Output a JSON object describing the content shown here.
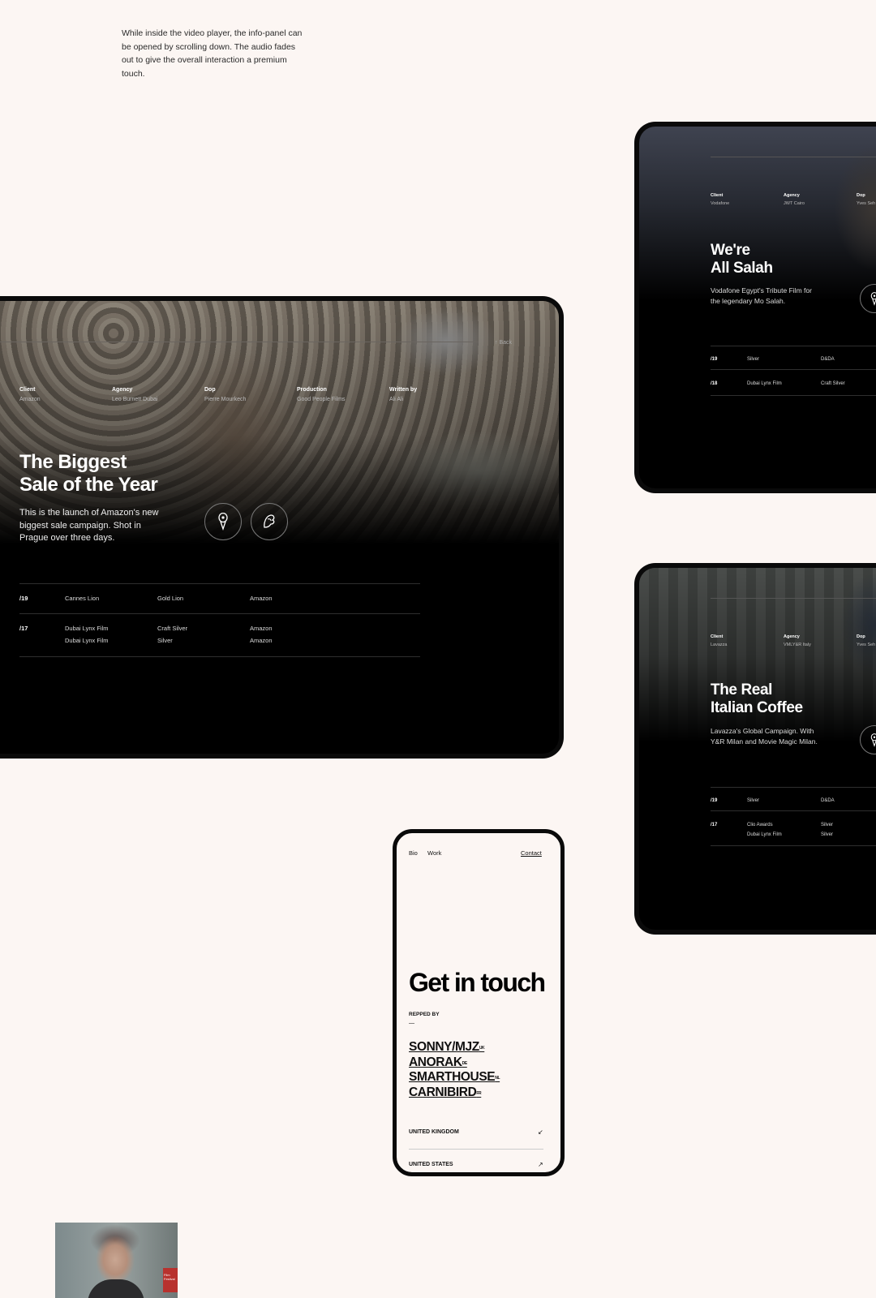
{
  "intro_text": "While inside the video player, the info-panel can be opened by scrolling down. The audio fades out to give the overall interaction a premium touch.",
  "main_project": {
    "back_label": "↑ Back",
    "meta": [
      {
        "key": "Client",
        "value": "Amazon"
      },
      {
        "key": "Agency",
        "value": "Leo Burnett Dubai"
      },
      {
        "key": "Dop",
        "value": "Pierre Mourkech"
      },
      {
        "key": "Production",
        "value": "Good People Films"
      },
      {
        "key": "Written by",
        "value": "Ali Ali"
      }
    ],
    "title_line1": "The Biggest",
    "title_line2": "Sale of the Year",
    "description": "This is the launch of Amazon's new biggest sale campaign. Shot in Prague over three days.",
    "award_icons": [
      "award-trophy-icon",
      "cannes-lion-icon"
    ],
    "awards": [
      {
        "year": "/19",
        "festival": "Cannes Lion",
        "award": "Gold Lion",
        "client": "Amazon"
      },
      {
        "year": "/17",
        "festival": "Dubai Lynx Film",
        "award": "Craft Silver",
        "client": "Amazon"
      },
      {
        "year": "",
        "festival": "Dubai Lynx Film",
        "award": "Silver",
        "client": "Amazon"
      }
    ]
  },
  "salah_project": {
    "meta": [
      {
        "key": "Client",
        "value": "Vodafone"
      },
      {
        "key": "Agency",
        "value": "JWT Cairo"
      },
      {
        "key": "Dop",
        "value": "Yves Seh"
      }
    ],
    "title_line1": "We're",
    "title_line2": "All Salah",
    "description": "Vodafone Egypt's Tribute Film for the legendary Mo Salah.",
    "awards": [
      {
        "year": "/19",
        "festival": "Silver",
        "award": "D&DA"
      },
      {
        "year": "/18",
        "festival": "Dubai Lynx Film",
        "award": "Craft Silver"
      }
    ]
  },
  "coffee_project": {
    "meta": [
      {
        "key": "Client",
        "value": "Lavazza"
      },
      {
        "key": "Agency",
        "value": "VMLY&R Italy"
      },
      {
        "key": "Dop",
        "value": "Yves Seh"
      }
    ],
    "title_line1": "The Real",
    "title_line2": "Italian Coffee",
    "description": "Lavazza's Global Campaign. With Y&R Milan and Movie Magic Milan.",
    "awards": [
      {
        "year": "/19",
        "festival": "Silver",
        "award": "D&DA"
      },
      {
        "year": "/17",
        "festival": "Clio Awards",
        "award": "Silver"
      },
      {
        "year": "",
        "festival": "Dubai Lynx Film",
        "award": "Silver"
      }
    ]
  },
  "phone": {
    "nav_bio": "Bio",
    "nav_work": "Work",
    "nav_contact": "Contact",
    "heading": "Get in touch",
    "repped_label": "REPPED BY",
    "dash": "—",
    "agencies": [
      {
        "name": "SONNY/MJZ",
        "country": "UK"
      },
      {
        "name": "ANORAK",
        "country": "DE"
      },
      {
        "name": "SMARTHOUSE",
        "country": "NL"
      },
      {
        "name": "CARNIBIRD",
        "country": "FR"
      }
    ],
    "regions": [
      {
        "name": "UNITED  KINGDOM",
        "arrow": "↙"
      },
      {
        "name": "UNITED STATES",
        "arrow": "↗"
      }
    ]
  },
  "thumbnail_badge": "Film Festival"
}
